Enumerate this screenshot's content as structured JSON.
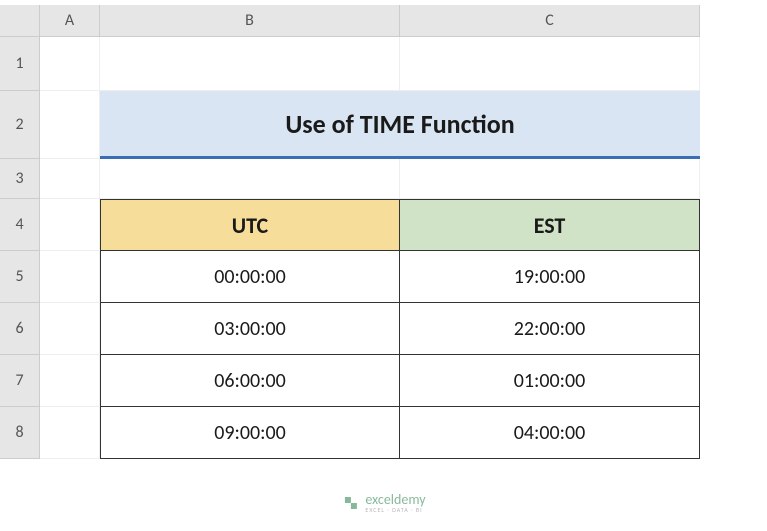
{
  "columns": [
    "A",
    "B",
    "C"
  ],
  "rows": [
    "1",
    "2",
    "3",
    "4",
    "5",
    "6",
    "7",
    "8"
  ],
  "title": "Use of TIME Function",
  "headers": {
    "utc": "UTC",
    "est": "EST"
  },
  "data": [
    {
      "utc": "00:00:00",
      "est": "19:00:00"
    },
    {
      "utc": "03:00:00",
      "est": "22:00:00"
    },
    {
      "utc": "06:00:00",
      "est": "01:00:00"
    },
    {
      "utc": "09:00:00",
      "est": "04:00:00"
    }
  ],
  "watermark": {
    "main": "exceldemy",
    "sub": "EXCEL · DATA · BI"
  }
}
